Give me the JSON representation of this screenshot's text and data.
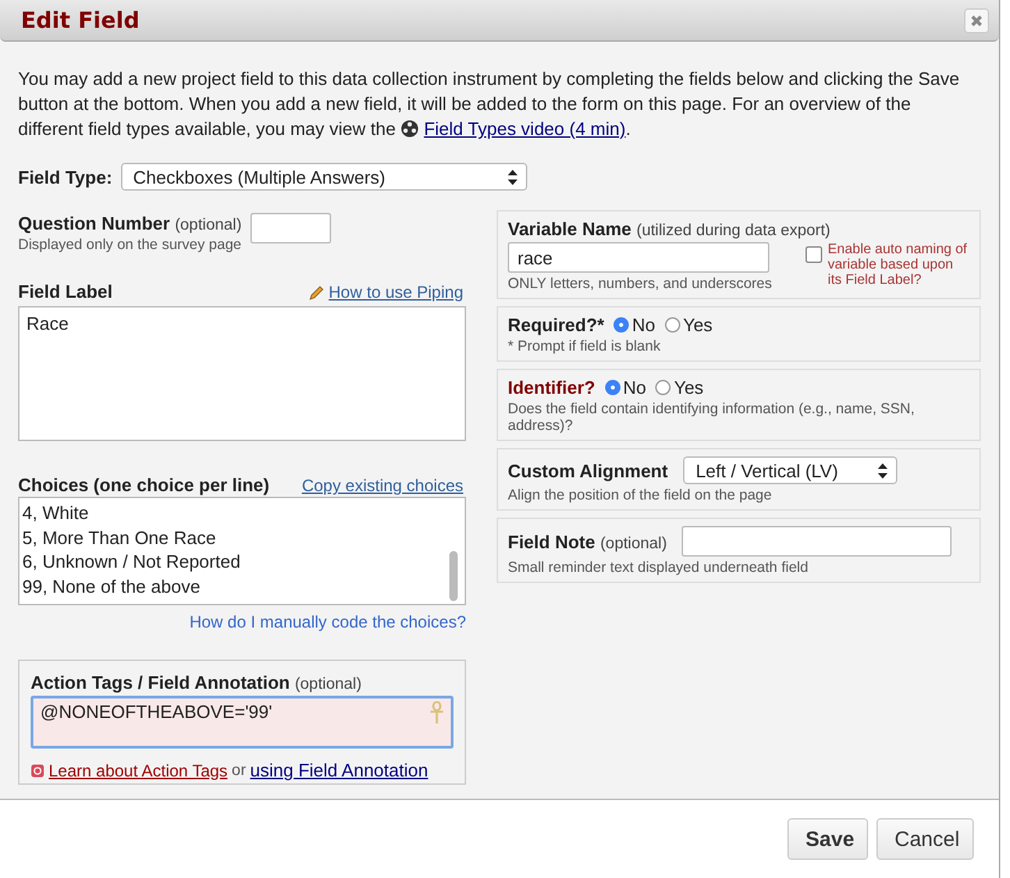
{
  "window": {
    "title": "Edit Field"
  },
  "intro": {
    "text": "You may add a new project field to this data collection instrument by completing the fields below and clicking the Save button at the bottom. When you add a new field, it will be added to the form on this page. For an overview of the different field types available, you may view the",
    "link": "Field Types video (4 min)",
    "end": "."
  },
  "field_type": {
    "label": "Field Type:",
    "value": "Checkboxes (Multiple Answers)"
  },
  "question_number": {
    "label": "Question Number",
    "optional": "(optional)",
    "hint": "Displayed only on the survey page"
  },
  "field_label": {
    "label": "Field Label",
    "link": "How to use Piping",
    "value": "Race"
  },
  "choices": {
    "label": "Choices (one choice per line)",
    "link": "Copy existing choices",
    "lines": [
      "4, White",
      "5, More Than One Race",
      "6, Unknown / Not Reported",
      "99, None of the above"
    ],
    "help_link": "How do I manually code the choices?"
  },
  "action_tags": {
    "label": "Action Tags / Field Annotation",
    "optional": "(optional)",
    "value": "@NONEOFTHEABOVE='99'",
    "link1": "Learn about Action Tags",
    "or": "or",
    "link2": "using Field Annotation"
  },
  "variable_name": {
    "label": "Variable Name",
    "note": "(utilized during data export)",
    "value": "race",
    "hint": "ONLY letters, numbers, and underscores",
    "auto_label": "Enable auto naming of variable based upon its Field Label?",
    "auto_checked": false
  },
  "required": {
    "label": "Required?*",
    "options": [
      {
        "label": "No",
        "selected": true
      },
      {
        "label": "Yes",
        "selected": false
      }
    ],
    "hint": "* Prompt if field is blank"
  },
  "identifier": {
    "label": "Identifier?",
    "options": [
      {
        "label": "No",
        "selected": true
      },
      {
        "label": "Yes",
        "selected": false
      }
    ],
    "hint": "Does the field contain identifying information (e.g., name, SSN, address)?"
  },
  "alignment": {
    "label": "Custom Alignment",
    "value": "Left / Vertical (LV)",
    "hint": "Align the position of the field on the page"
  },
  "field_note": {
    "label": "Field Note",
    "optional": "(optional)",
    "hint": "Small reminder text displayed underneath field"
  },
  "buttons": [
    {
      "label": "Save",
      "kind": "primary"
    },
    {
      "label": "Cancel",
      "kind": "secondary"
    }
  ]
}
